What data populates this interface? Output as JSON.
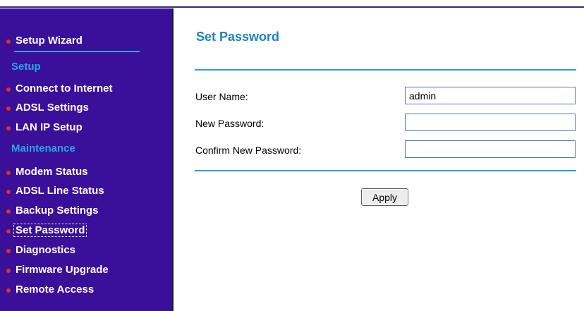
{
  "sidebar": {
    "setup_wizard": "Setup Wizard",
    "setup_heading": "Setup",
    "setup_items": [
      "Connect to Internet",
      "ADSL Settings",
      "LAN IP Setup"
    ],
    "maintenance_heading": "Maintenance",
    "maintenance_items": [
      "Modem Status",
      "ADSL Line Status",
      "Backup Settings",
      "Set Password",
      "Diagnostics",
      "Firmware Upgrade",
      "Remote Access"
    ]
  },
  "main": {
    "title": "Set Password",
    "fields": {
      "user_name_label": "User Name:",
      "user_name_value": "admin",
      "new_password_label": "New Password:",
      "new_password_value": "",
      "confirm_password_label": "Confirm New Password:",
      "confirm_password_value": ""
    },
    "apply_label": "Apply"
  },
  "colors": {
    "sidebar_bg": "#3a0f9a",
    "section_heading": "#29a6e3",
    "bullet": "#e0301e",
    "title": "#1b82c2",
    "rule": "#2a9ed8"
  }
}
